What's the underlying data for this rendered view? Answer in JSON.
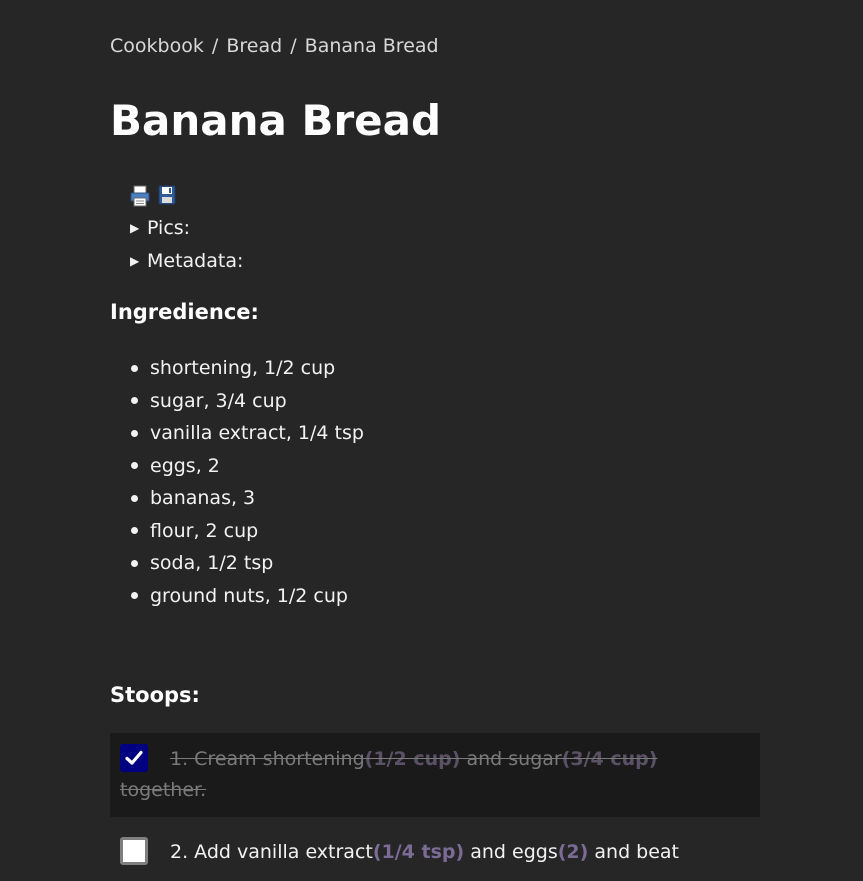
{
  "breadcrumb": {
    "items": [
      "Cookbook",
      "Bread",
      "Banana Bread"
    ],
    "separator": "/"
  },
  "title": "Banana Bread",
  "tools": {
    "icons": [
      "printer-icon",
      "floppy-disk-icon"
    ]
  },
  "details": {
    "pics_label": "Pics:",
    "metadata_label": "Metadata:"
  },
  "ingredients": {
    "heading": "Ingredience:",
    "items": [
      "shortening, 1/2 cup",
      "sugar, 3/4 cup",
      "vanilla extract, 1/4 tsp",
      "eggs, 2",
      "bananas, 3",
      "flour, 2 cup",
      "soda, 1/2 tsp",
      "ground nuts, 1/2 cup"
    ]
  },
  "steps": {
    "heading": "Stoops:",
    "items": [
      {
        "checked": true,
        "line1_a": "1. Cream shortening",
        "line1_q1": "(1/2 cup)",
        "line1_b": " and sugar",
        "line1_q2": "(3/4 cup)",
        "line2": "together."
      },
      {
        "checked": false,
        "line1_a": "2. Add vanilla extract",
        "line1_q1": "(1/4 tsp)",
        "line1_b": " and eggs",
        "line1_q2": "(2)",
        "line1_c": " and beat"
      }
    ]
  },
  "colors": {
    "background": "#262626",
    "checked_step_background": "#1a1a1a",
    "checkbox_checked": "#000080",
    "quantity": "#7b6b96"
  }
}
